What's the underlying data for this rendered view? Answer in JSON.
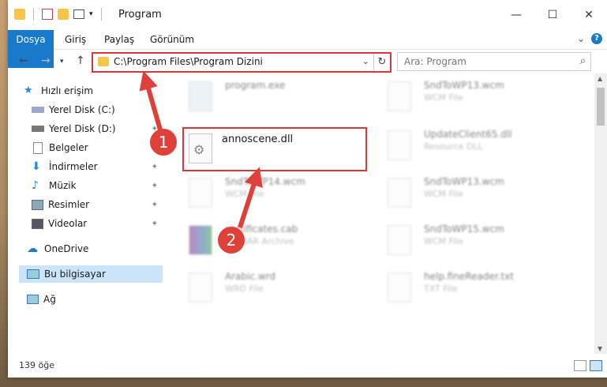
{
  "window": {
    "title": "Program"
  },
  "ribbon": {
    "tabs": [
      "Dosya",
      "Giriş",
      "Paylaş",
      "Görünüm"
    ],
    "help": "?"
  },
  "address": {
    "path": "C:\\Program Files\\Program Dizini"
  },
  "search": {
    "placeholder": "Ara: Program"
  },
  "nav": {
    "items": [
      {
        "label": "Hızlı erişim",
        "icon": "star-icon"
      },
      {
        "label": "Yerel Disk (C:)",
        "icon": "drive-icon"
      },
      {
        "label": "Yerel Disk (D:)",
        "icon": "drive-icon"
      },
      {
        "label": "Belgeler",
        "icon": "documents-icon"
      },
      {
        "label": "İndirmeler",
        "icon": "download-icon"
      },
      {
        "label": "Müzik",
        "icon": "music-icon"
      },
      {
        "label": "Resimler",
        "icon": "pictures-icon"
      },
      {
        "label": "Videolar",
        "icon": "videos-icon"
      },
      {
        "label": "OneDrive",
        "icon": "cloud-icon"
      },
      {
        "label": "Bu bilgisayar",
        "icon": "computer-icon"
      },
      {
        "label": "Ağ",
        "icon": "network-icon"
      }
    ]
  },
  "files": [
    {
      "name": "program.exe",
      "sub": ""
    },
    {
      "name": "SndToWP13.wcm",
      "sub": "WCM File"
    },
    {
      "name": "annoscene.dll",
      "sub": ""
    },
    {
      "name": "UpdateClient65.dll",
      "sub": "Resource DLL"
    },
    {
      "name": "SndToWP14.wcm",
      "sub": "WCM File"
    },
    {
      "name": "SndToWP13.wcm",
      "sub": "WCM File"
    },
    {
      "name": "certificates.cab",
      "sub": "WinRAR Archive"
    },
    {
      "name": "SndToWP15.wcm",
      "sub": "WCM File"
    },
    {
      "name": "Arabic.wrd",
      "sub": "WRD File"
    },
    {
      "name": "help.fineReader.txt",
      "sub": "TXT File"
    }
  ],
  "status": {
    "count": "139 öğe"
  },
  "callouts": [
    "1",
    "2"
  ],
  "colors": {
    "accent": "#1979ca",
    "highlight": "#d9363e"
  }
}
